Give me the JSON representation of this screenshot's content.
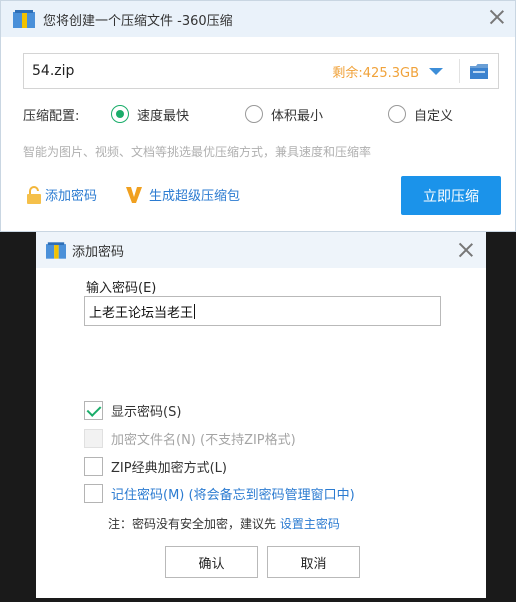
{
  "main_window": {
    "title": "您将创建一个压缩文件 -360压缩",
    "path_value": "54.zip",
    "free_space": "剩余:425.3GB",
    "config_label": "压缩配置:",
    "options": [
      "速度最快",
      "体积最小",
      "自定义"
    ],
    "selected_option": "速度最快",
    "hint": "智能为图片、视频、文档等挑选最优压缩方式，兼具速度和压缩率",
    "add_password_link": "添加密码",
    "super_package_link": "生成超级压缩包",
    "compress_button": "立即压缩"
  },
  "dialog": {
    "title": "添加密码",
    "input_label": "输入密码(E)",
    "password_value": "上老王论坛当老王",
    "checkboxes": [
      {
        "label": "显示密码(S)",
        "checked": true,
        "enabled": true
      },
      {
        "label": "加密文件名(N) (不支持ZIP格式)",
        "checked": false,
        "enabled": false
      },
      {
        "label": "ZIP经典加密方式(L)",
        "checked": false,
        "enabled": true
      },
      {
        "label": "记住密码(M) (将会备忘到密码管理窗口中)",
        "checked": false,
        "enabled": true
      }
    ],
    "note_prefix": "注：密码没有安全加密，建议先 ",
    "note_link": "设置主密码",
    "ok_button": "确认",
    "cancel_button": "取消"
  },
  "colors": {
    "accent": "#1b93ea",
    "link": "#2b7bd1",
    "free_space": "#f0a23a",
    "check": "#1aad6a"
  },
  "icons": [
    "app-icon",
    "close-icon",
    "dropdown-arrow-icon",
    "folder-icon",
    "lock-icon",
    "v-icon",
    "checkmark-icon"
  ]
}
